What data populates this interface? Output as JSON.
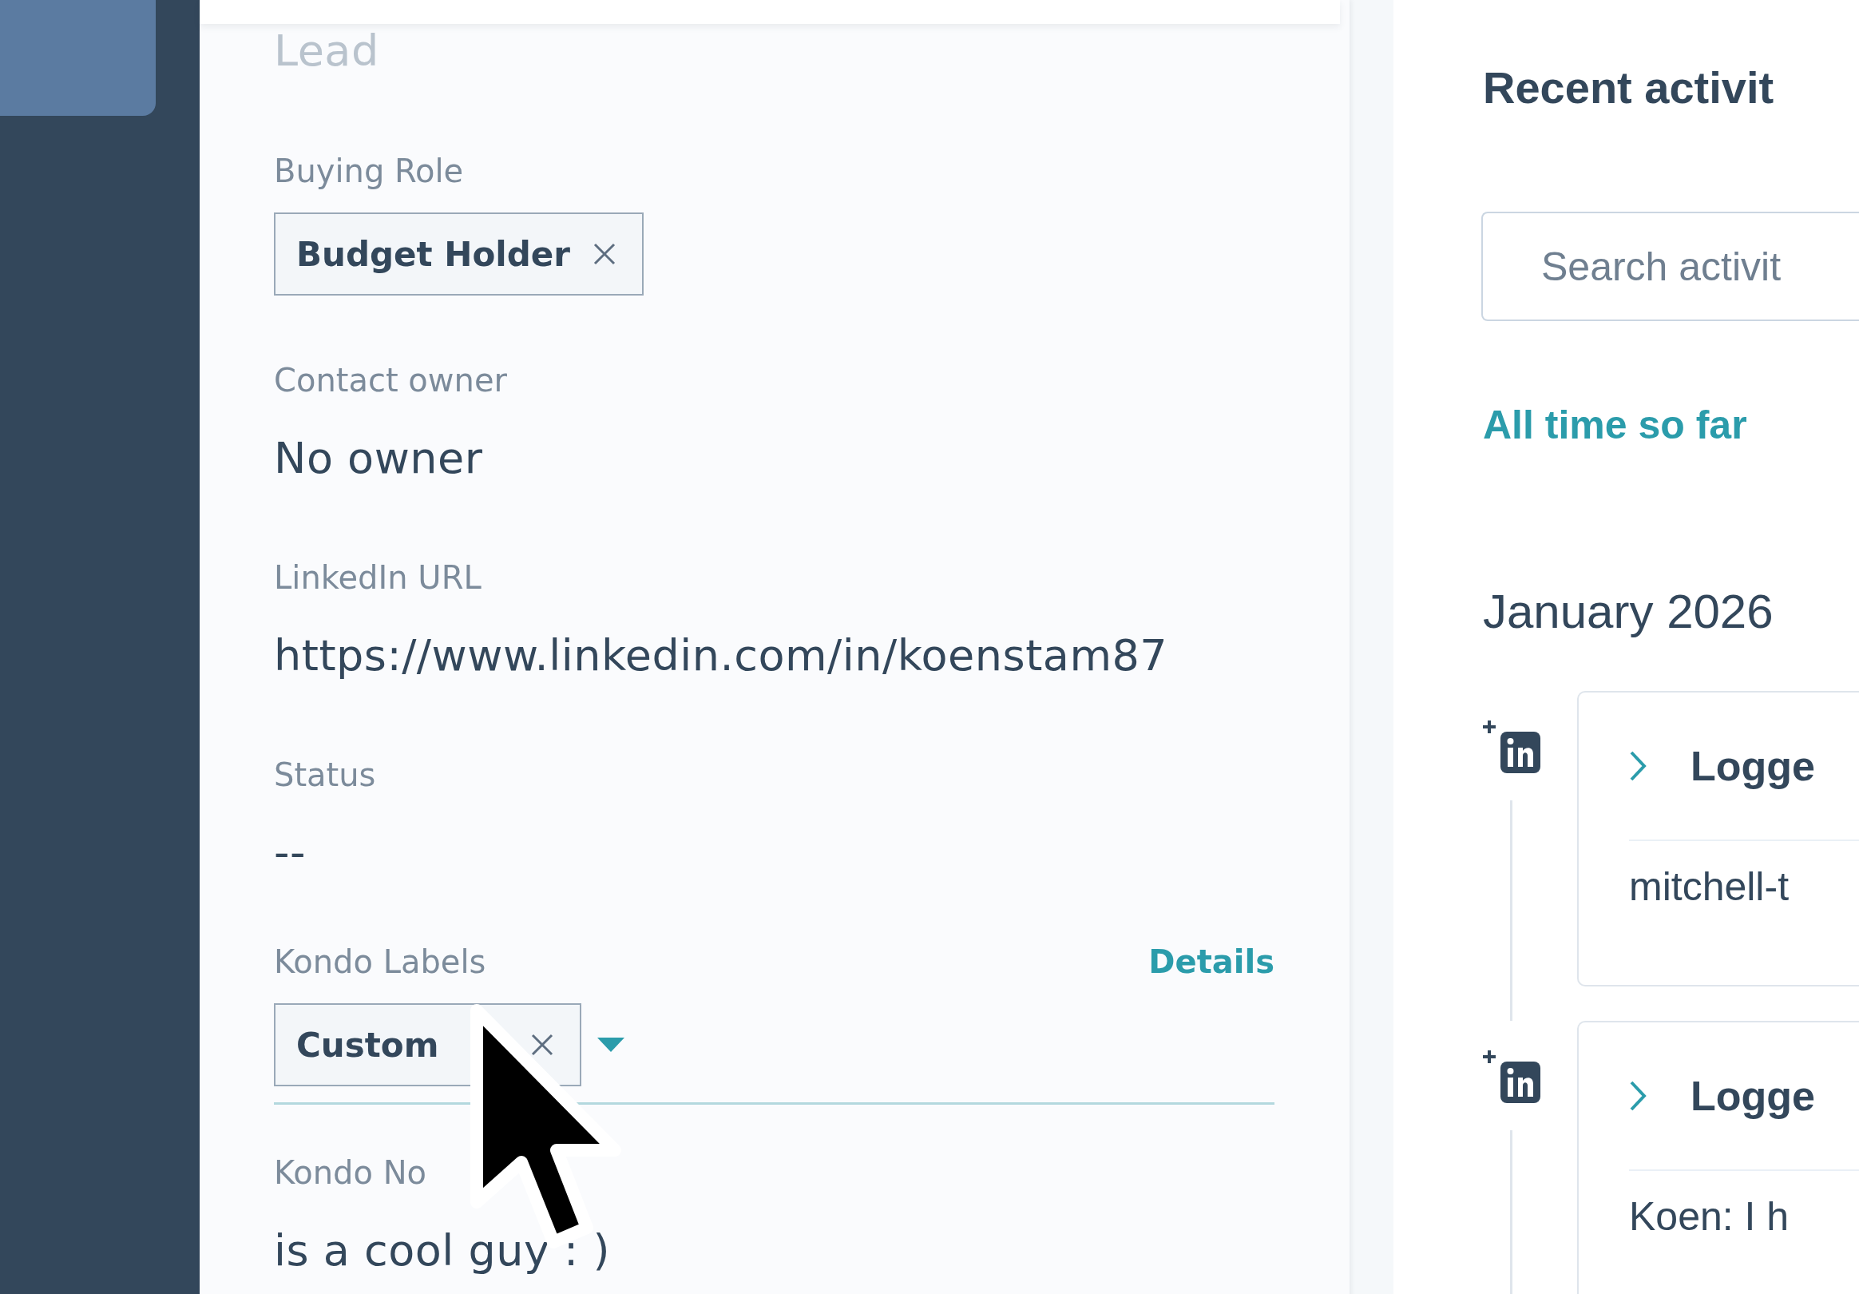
{
  "properties": [
    {
      "kind": "text",
      "value": "Lead",
      "faded": true
    },
    {
      "kind": "tags",
      "label": "Buying Role",
      "tags": [
        {
          "label": "Budget Holder"
        }
      ]
    },
    {
      "kind": "text",
      "label": "Contact owner",
      "value": "No owner",
      "faded": false
    },
    {
      "kind": "text",
      "label": "LinkedIn URL",
      "value": "https://www.linkedin.com/in/koenstam87",
      "faded": false
    },
    {
      "kind": "text",
      "label": "Status",
      "value": "--",
      "faded": false
    },
    {
      "kind": "tags_select",
      "label": "Kondo Labels",
      "action": "Details",
      "tags": [
        {
          "label": "Custom"
        }
      ]
    },
    {
      "kind": "text",
      "label": "Kondo No",
      "value": "is a cool guy : )",
      "faded": false
    }
  ],
  "activity": {
    "title": "Recent activit",
    "search": {
      "placeholder": "Search activit"
    },
    "filter": "All time so far",
    "month": "January 2026",
    "entries": [
      {
        "title": "Logge",
        "body": "mitchell-t"
      },
      {
        "title": "Logge",
        "body": "Koen: I h"
      }
    ]
  }
}
